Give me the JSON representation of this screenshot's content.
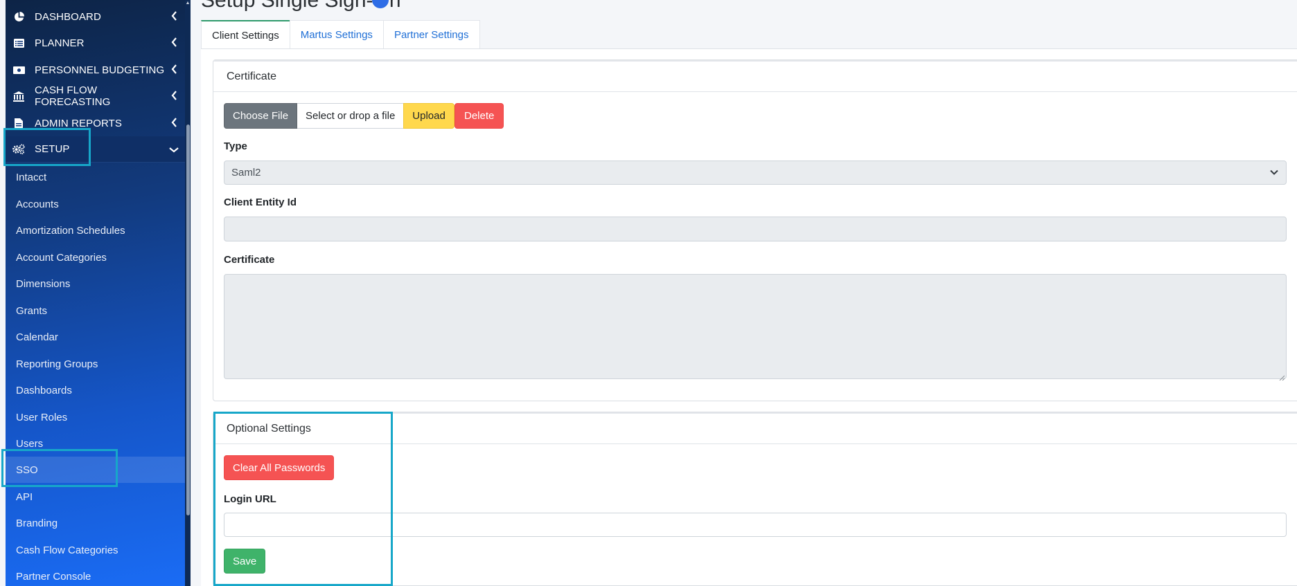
{
  "sidebar": {
    "top_items": [
      {
        "label": "DASHBOARD",
        "icon": "pie-chart-icon"
      },
      {
        "label": "PLANNER",
        "icon": "list-icon"
      },
      {
        "label": "PERSONNEL BUDGETING",
        "icon": "money-icon"
      },
      {
        "label": "CASH FLOW FORECASTING",
        "icon": "bank-icon"
      },
      {
        "label": "ADMIN REPORTS",
        "icon": "report-icon"
      },
      {
        "label": "SETUP",
        "icon": "gears-icon"
      }
    ],
    "setup_items": [
      "Intacct",
      "Accounts",
      "Amortization Schedules",
      "Account Categories",
      "Dimensions",
      "Grants",
      "Calendar",
      "Reporting Groups",
      "Dashboards",
      "User Roles",
      "Users",
      "SSO",
      "API",
      "Branding",
      "Cash Flow Categories",
      "Partner Console"
    ],
    "active_item": "SSO"
  },
  "page": {
    "title": "Setup Single Sign-On"
  },
  "tabs": [
    {
      "label": "Client Settings",
      "active": true
    },
    {
      "label": "Martus Settings",
      "active": false
    },
    {
      "label": "Partner Settings",
      "active": false
    }
  ],
  "certificate_card": {
    "header": "Certificate",
    "choose_file_label": "Choose File",
    "file_placeholder": "Select or drop a file",
    "upload_label": "Upload",
    "delete_label": "Delete",
    "type_label": "Type",
    "type_value": "Saml2",
    "client_entity_id_label": "Client Entity Id",
    "client_entity_id_value": "",
    "certificate_label": "Certificate",
    "certificate_value": ""
  },
  "optional_card": {
    "header": "Optional Settings",
    "clear_passwords_label": "Clear All Passwords",
    "login_url_label": "Login URL",
    "login_url_value": "",
    "save_label": "Save"
  },
  "colors": {
    "highlight": "#17a7c9",
    "link": "#1f6fd6",
    "danger": "#f55353",
    "warning": "#ffd84d",
    "success": "#3fb36a"
  }
}
